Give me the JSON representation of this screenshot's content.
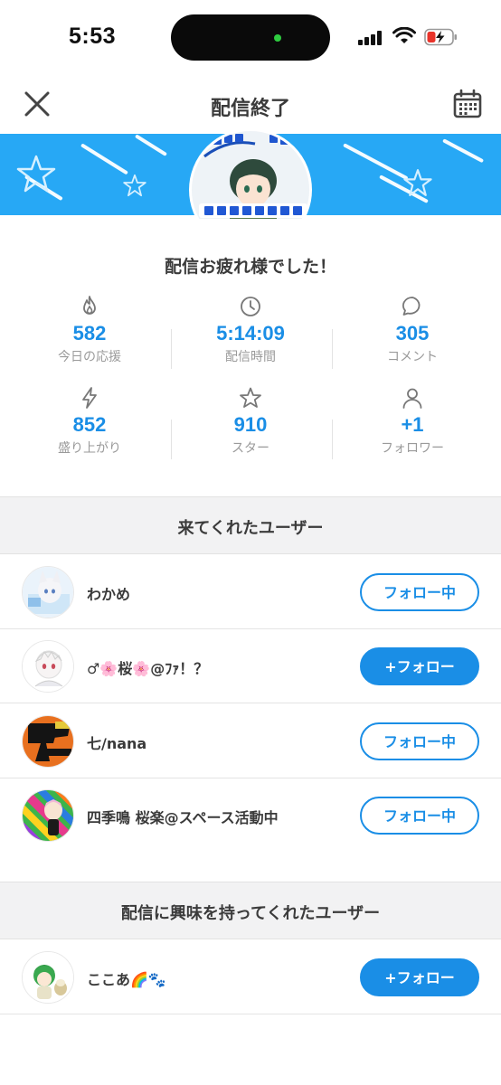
{
  "status_bar": {
    "time": "5:53"
  },
  "nav": {
    "title": "配信終了"
  },
  "summary": {
    "greeting": "配信お疲れ様でした！",
    "stats": [
      {
        "icon": "flame-icon",
        "value": "582",
        "label": "今日の応援"
      },
      {
        "icon": "clock-icon",
        "value": "5:14:09",
        "label": "配信時間"
      },
      {
        "icon": "comment-icon",
        "value": "305",
        "label": "コメント"
      },
      {
        "icon": "lightning-icon",
        "value": "852",
        "label": "盛り上がり"
      },
      {
        "icon": "star-icon",
        "value": "910",
        "label": "スター"
      },
      {
        "icon": "person-icon",
        "value": "+1",
        "label": "フォロワー"
      }
    ]
  },
  "visitors": {
    "title": "来てくれたユーザー",
    "users": [
      {
        "name": "わかめ",
        "button": "フォロー中",
        "following": true
      },
      {
        "name": "♂🌸桜🌸@ﾌｧ！？",
        "button": "+フォロー",
        "following": false
      },
      {
        "name": "七/nana",
        "button": "フォロー中",
        "following": true
      },
      {
        "name": "四季鳴 桜楽@スペース活動中",
        "button": "フォロー中",
        "following": true
      }
    ]
  },
  "interested": {
    "title": "配信に興味を持ってくれたユーザー",
    "users": [
      {
        "name": "ここあ🌈🐾",
        "button": "+フォロー",
        "following": false
      }
    ]
  },
  "colors": {
    "accent": "#1a8ee6",
    "banner": "#27a8f5",
    "section_bg": "#f2f2f3"
  }
}
